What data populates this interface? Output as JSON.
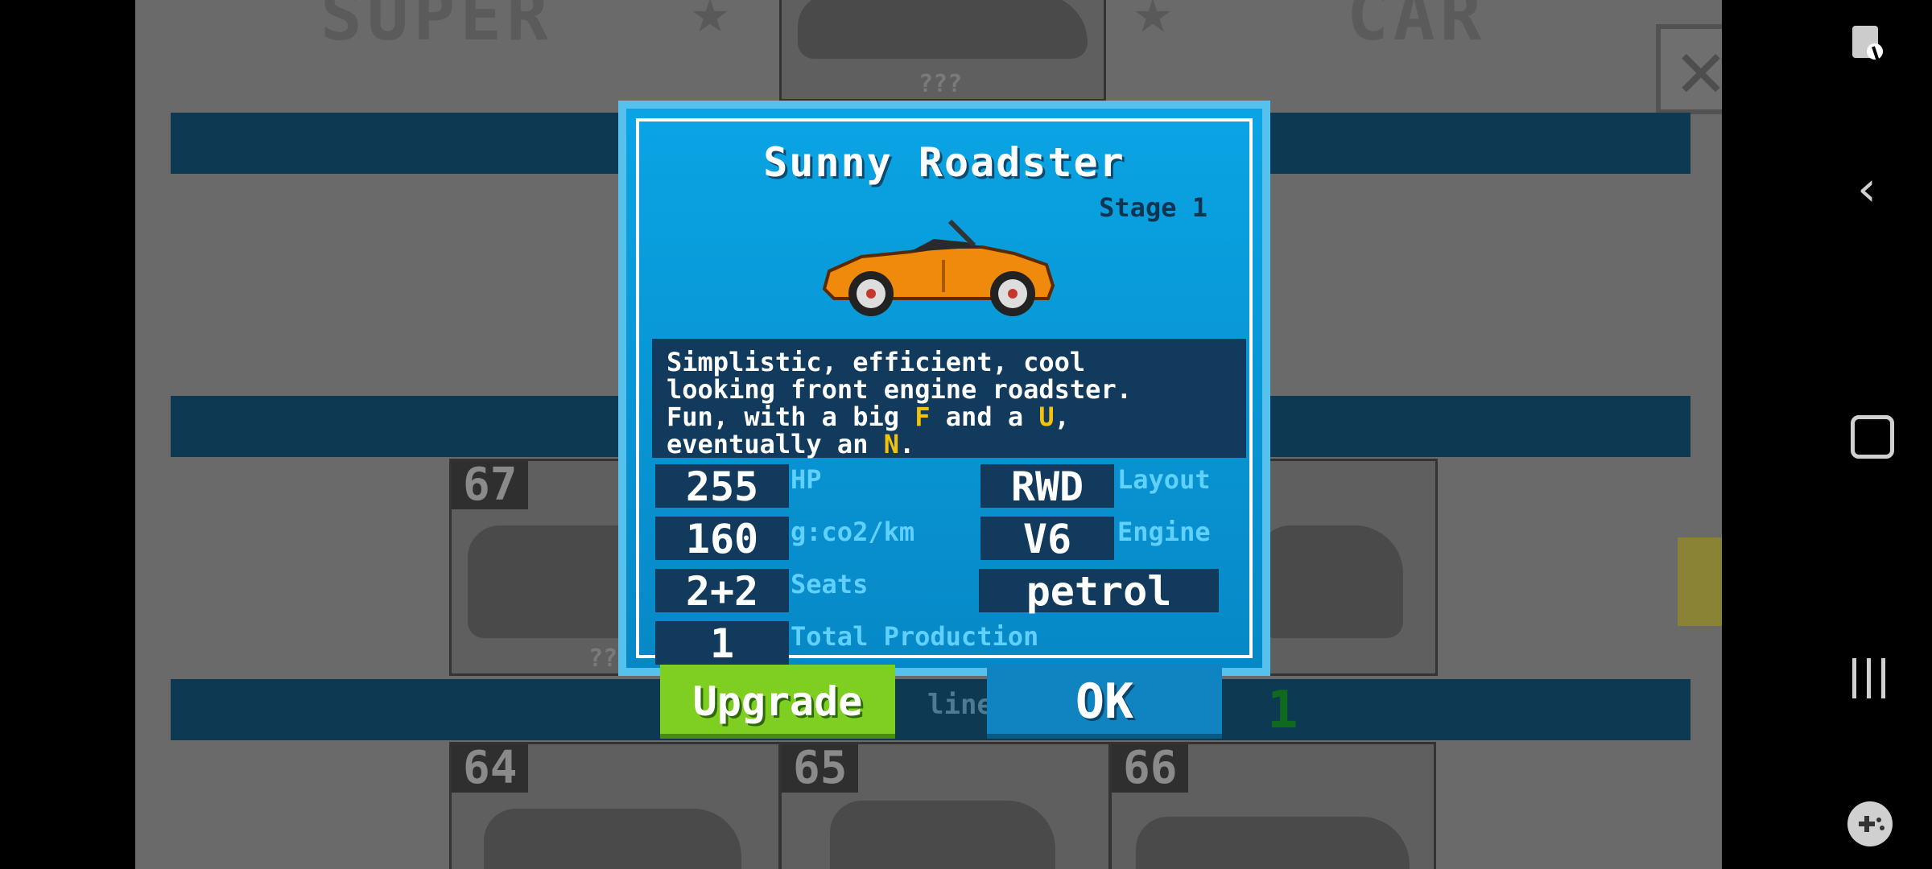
{
  "background": {
    "title_left": "SUPER",
    "title_right": "CAR",
    "locked_label": "???",
    "card_numbers": [
      "67",
      "64",
      "65",
      "66"
    ],
    "band_text": "line t",
    "band_count": "1"
  },
  "dialog": {
    "title": "Sunny Roadster",
    "stage": "Stage 1",
    "description_parts": {
      "p1": "Simplistic, efficient, cool\nlooking front engine roadster.\nFun, with a big ",
      "h1": "F",
      "p2": " and a ",
      "h2": "U",
      "p3": ",\neventually an ",
      "h3": "N",
      "p4": "."
    },
    "stats": {
      "hp_value": "255",
      "hp_label": "HP",
      "co2_value": "160",
      "co2_label": "g:co2/km",
      "seats_value": "2+2",
      "seats_label": "Seats",
      "production_value": "1",
      "production_label": "Total Production",
      "layout_value": "RWD",
      "layout_label": "Layout",
      "engine_value": "V6",
      "engine_label": "Engine",
      "fuel_value": "petrol"
    },
    "buttons": {
      "upgrade": "Upgrade",
      "ok": "OK"
    },
    "car_color": "#f08a0c"
  },
  "nav_icons": [
    "screenshot-edit-icon",
    "back-icon",
    "home-icon",
    "recents-icon",
    "game-controller-icon"
  ]
}
